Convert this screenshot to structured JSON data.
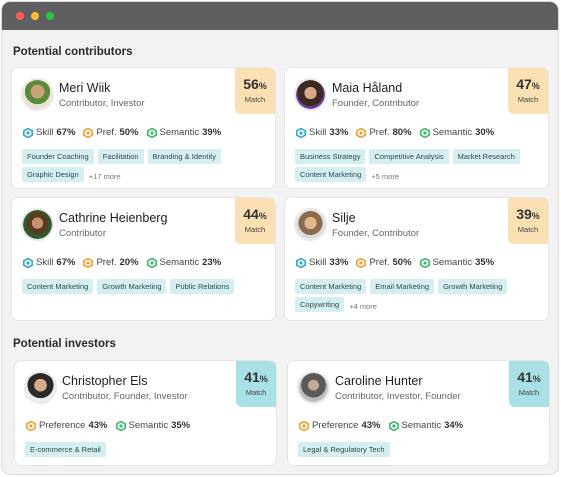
{
  "sections": {
    "contributors_title": "Potential contributors",
    "investors_title": "Potential investors"
  },
  "match_label": "Match",
  "contributors": [
    {
      "name": "Meri Wiik",
      "role": "Contributor, Investor",
      "match": "56",
      "scores": [
        {
          "label": "Skill",
          "value": "67%",
          "icon": "skill-icon"
        },
        {
          "label": "Pref.",
          "value": "50%",
          "icon": "preference-icon"
        },
        {
          "label": "Semantic",
          "value": "39%",
          "icon": "semantic-icon"
        }
      ],
      "tags": [
        "Founder Coaching",
        "Facilitation",
        "Branding & Identity",
        "Graphic Design"
      ],
      "more": "+17 more"
    },
    {
      "name": "Maia Håland",
      "role": "Founder, Contributor",
      "match": "47",
      "scores": [
        {
          "label": "Skill",
          "value": "33%",
          "icon": "skill-icon"
        },
        {
          "label": "Pref.",
          "value": "80%",
          "icon": "preference-icon"
        },
        {
          "label": "Semantic",
          "value": "30%",
          "icon": "semantic-icon"
        }
      ],
      "tags": [
        "Business Strategy",
        "Competitive Analysis",
        "Market Research",
        "Content Marketing"
      ],
      "more": "+5 more"
    },
    {
      "name": "Cathrine Heienberg",
      "role": "Contributor",
      "match": "44",
      "scores": [
        {
          "label": "Skill",
          "value": "67%",
          "icon": "skill-icon"
        },
        {
          "label": "Pref.",
          "value": "20%",
          "icon": "preference-icon"
        },
        {
          "label": "Semantic",
          "value": "23%",
          "icon": "semantic-icon"
        }
      ],
      "tags": [
        "Content Marketing",
        "Growth Marketing",
        "Public Relations"
      ],
      "more": ""
    },
    {
      "name": "Silje",
      "role": "Founder, Contributor",
      "match": "39",
      "scores": [
        {
          "label": "Skill",
          "value": "33%",
          "icon": "skill-icon"
        },
        {
          "label": "Pref.",
          "value": "50%",
          "icon": "preference-icon"
        },
        {
          "label": "Semantic",
          "value": "35%",
          "icon": "semantic-icon"
        }
      ],
      "tags": [
        "Content Marketing",
        "Email Marketing",
        "Growth Marketing",
        "Copywriting"
      ],
      "more": "+4 more"
    }
  ],
  "investors": [
    {
      "name": "Christopher Els",
      "role": "Contributor, Founder, Investor",
      "match": "41",
      "scores": [
        {
          "label": "Preference",
          "value": "43%",
          "icon": "preference-icon"
        },
        {
          "label": "Semantic",
          "value": "35%",
          "icon": "semantic-icon"
        }
      ],
      "tags": [
        "E-commerce & Retail"
      ],
      "more": ""
    },
    {
      "name": "Caroline Hunter",
      "role": "Contributor, Investor, Founder",
      "match": "41",
      "scores": [
        {
          "label": "Preference",
          "value": "43%",
          "icon": "preference-icon"
        },
        {
          "label": "Semantic",
          "value": "34%",
          "icon": "semantic-icon"
        }
      ],
      "tags": [
        "Legal & Regulatory Tech"
      ],
      "more": ""
    }
  ],
  "colors": {
    "skill": "#2fa8d0",
    "preference": "#f0a030",
    "semantic": "#3fb86a",
    "match_contributor": "#fbe0b4",
    "match_investor": "#a9e0e5",
    "tag_bg": "#d4eef1"
  }
}
